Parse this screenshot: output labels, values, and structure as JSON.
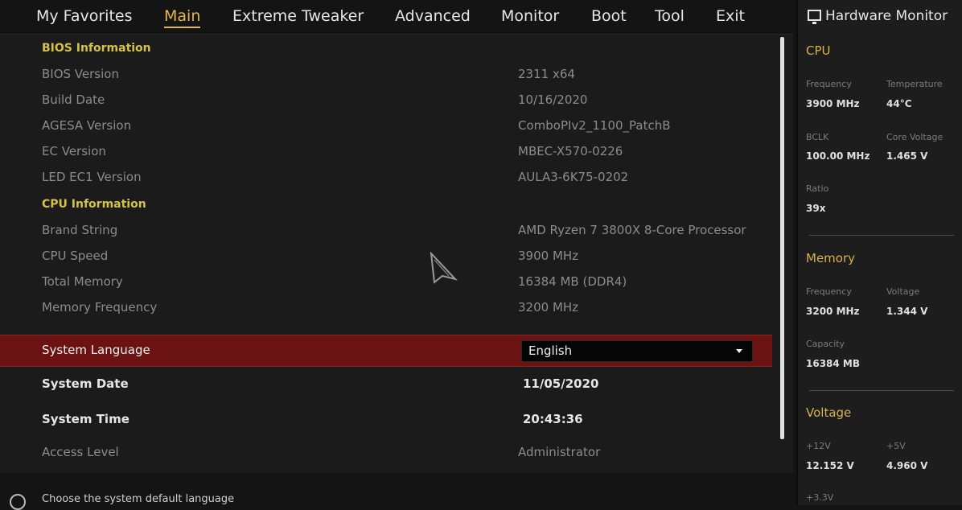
{
  "nav": {
    "tabs": [
      "My Favorites",
      "Main",
      "Extreme Tweaker",
      "Advanced",
      "Monitor",
      "Boot",
      "Tool",
      "Exit"
    ],
    "active": "Main"
  },
  "main": {
    "bios_section": "BIOS Information",
    "bios_version_label": "BIOS Version",
    "bios_version_value": "2311  x64",
    "build_date_label": "Build Date",
    "build_date_value": "10/16/2020",
    "agesa_label": "AGESA Version",
    "agesa_value": "ComboPIv2_1100_PatchB",
    "ec_label": "EC Version",
    "ec_value": "MBEC-X570-0226",
    "led_label": "LED EC1 Version",
    "led_value": "AULA3-6K75-0202",
    "cpu_section": "CPU Information",
    "brand_label": "Brand String",
    "brand_value": "AMD Ryzen 7 3800X 8-Core Processor",
    "cpu_speed_label": "CPU Speed",
    "cpu_speed_value": "3900 MHz",
    "total_mem_label": "Total Memory",
    "total_mem_value": "16384 MB (DDR4)",
    "mem_freq_label": "Memory Frequency",
    "mem_freq_value": "3200 MHz",
    "lang_label": "System Language",
    "lang_value": "English",
    "date_label": "System Date",
    "date_value": "11/05/2020",
    "time_label": "System Time",
    "time_value": "20:43:36",
    "access_label": "Access Level",
    "access_value": "Administrator",
    "help_text": "Choose the system default language"
  },
  "hw": {
    "title": "Hardware Monitor",
    "cpu_head": "CPU",
    "cpu_freq_k": "Frequency",
    "cpu_freq_v": "3900 MHz",
    "cpu_temp_k": "Temperature",
    "cpu_temp_v": "44°C",
    "bclk_k": "BCLK",
    "bclk_v": "100.00 MHz",
    "vcore_k": "Core Voltage",
    "vcore_v": "1.465 V",
    "ratio_k": "Ratio",
    "ratio_v": "39x",
    "mem_head": "Memory",
    "mem_freq_k": "Frequency",
    "mem_freq_v": "3200 MHz",
    "mem_volt_k": "Voltage",
    "mem_volt_v": "1.344 V",
    "cap_k": "Capacity",
    "cap_v": "16384 MB",
    "volt_head": "Voltage",
    "v12_k": "+12V",
    "v12_v": "12.152 V",
    "v5_k": "+5V",
    "v5_v": "4.960 V",
    "v33_k": "+3.3V"
  },
  "colors": {
    "accent": "#e5b64a",
    "section": "#d4c24a",
    "selection": "#6b1212"
  }
}
